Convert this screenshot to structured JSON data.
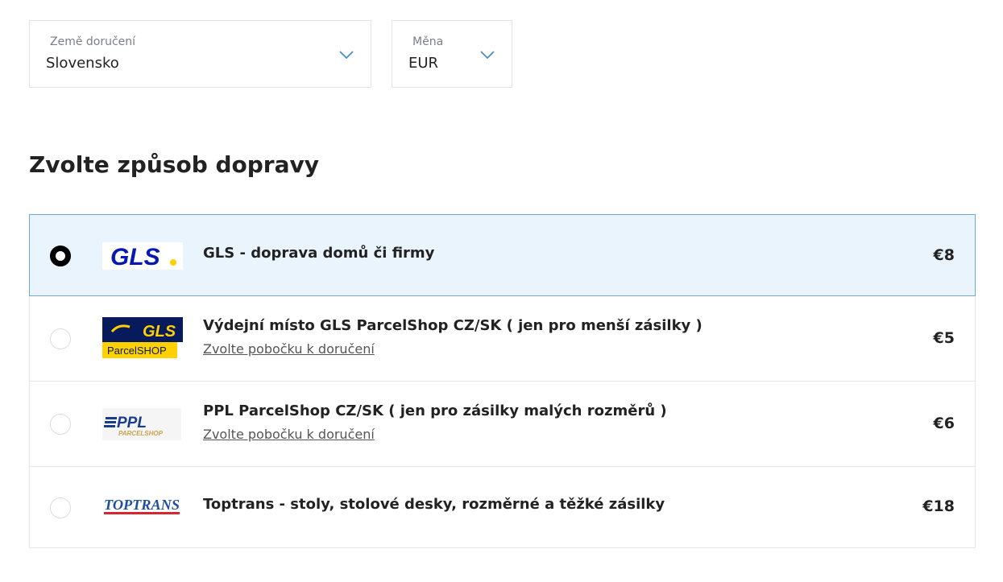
{
  "delivery_country": {
    "label": "Země doručení",
    "value": "Slovensko"
  },
  "currency": {
    "label": "Měna",
    "value": "EUR"
  },
  "shipping": {
    "heading": "Zvolte způsob dopravy",
    "options": [
      {
        "title": "GLS - doprava domů či firmy",
        "price": "€8",
        "selected": true,
        "logo": "gls-logo",
        "logo_text": "GLS"
      },
      {
        "title": "Výdejní místo GLS ParcelShop CZ/SK ( jen pro menší zásilky )",
        "link": "Zvolte pobočku k doručení",
        "price": "€5",
        "selected": false,
        "logo": "gls-parcelshop-logo",
        "logo_text": "GLS",
        "logo_subtext": "ParcelSHOP"
      },
      {
        "title": "PPL ParcelShop CZ/SK ( jen pro zásilky malých rozměrů )",
        "link": "Zvolte pobočku k doručení",
        "price": "€6",
        "selected": false,
        "logo": "ppl-parcelshop-logo",
        "logo_text": "PPL",
        "logo_subtext": "PARCELSHOP"
      },
      {
        "title": "Toptrans - stoly, stolové desky, rozměrné a těžké zásilky",
        "price": "€18",
        "selected": false,
        "logo": "toptrans-logo",
        "logo_text": "TOPTRANS"
      }
    ]
  },
  "colors": {
    "selected_bg": "#eaf4fc",
    "selected_border": "#6ea7d2",
    "chevron": "#4a90c2",
    "gls_blue": "#061ab1",
    "gls_yellow": "#ffd100"
  }
}
